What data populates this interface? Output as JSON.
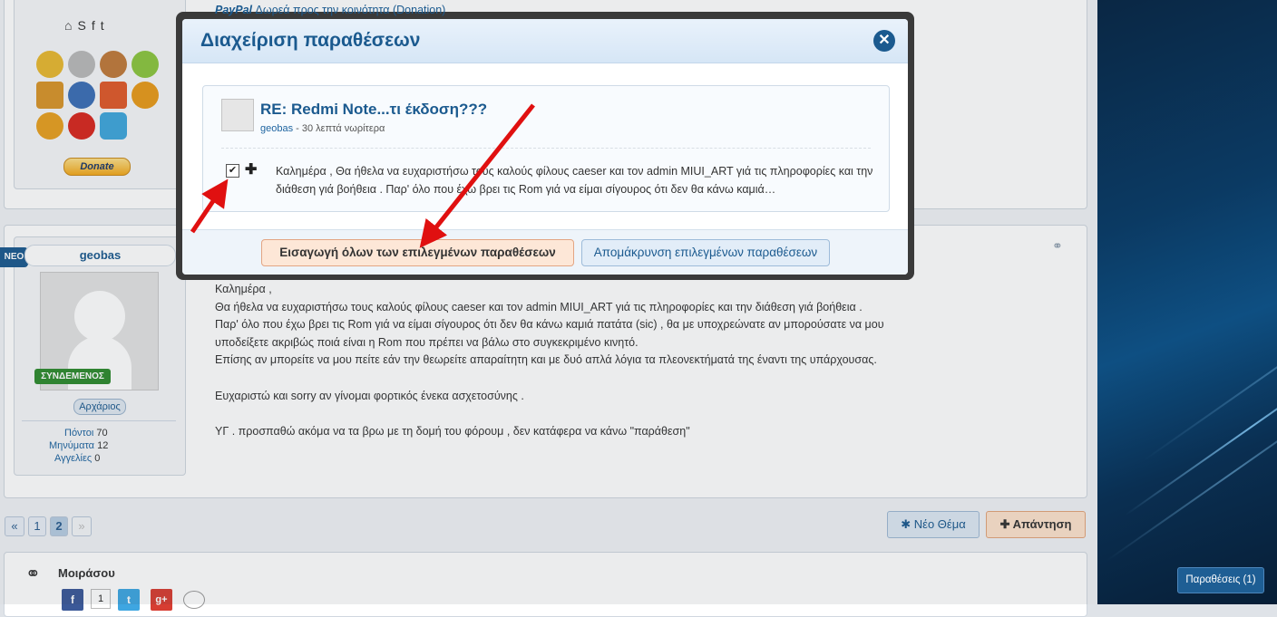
{
  "colors": {
    "accent": "#1b5a8f",
    "insert_bg": "#fde7d7",
    "online_green": "#2e8b2e",
    "arrow_red": "#e01010"
  },
  "top_post": {
    "paypal_brand": "PayPal",
    "paypal_link": "Δωρεά προς την κοινότητα (Donation)",
    "donate_label": "Donate",
    "social_icons": [
      "home-icon",
      "skype-icon",
      "facebook-icon",
      "twitter-icon"
    ]
  },
  "user": {
    "name": "geobas",
    "new_badge": "ΝΕΟ",
    "online": "ΣΥΝΔΕΜΕΝΟΣ",
    "rank": "Αρχάριος",
    "stats": [
      {
        "label": "Πόντοι",
        "value": "70"
      },
      {
        "label": "Μηνύματα",
        "value": "12"
      },
      {
        "label": "Αγγελίες",
        "value": "0"
      }
    ]
  },
  "post": {
    "lines": [
      "Καλημέρα ,",
      "Θα ήθελα να ευχαριστήσω τους καλούς φίλους caeser και τον admin MIUI_ART γιά τις πληροφορίες και την διάθεση γιά βοήθεια .",
      "Παρ' όλο που έχω βρει τις Rom γιά να είμαι σίγουρος ότι δεν θα κάνω καμιά πατάτα (sic) , θα με υποχρεώνατε αν μπορούσατε να μου",
      "υποδείξετε ακριβώς ποιά είναι η Rom που πρέπει να βάλω στο συγκεκριμένο κινητό.",
      "Επίσης αν μπορείτε να μου πείτε εάν την θεωρείτε απαραίτητη και με δυό απλά λόγια τα πλεονεκτήματά της έναντι της υπάρχουσας.",
      "",
      "Ευχαριστώ και sorry αν γίνομαι φορτικός ένεκα ασχετοσύνης .",
      "",
      "ΥΓ . προσπαθώ ακόμα να τα βρω με τη δομή του φόρουμ , δεν κατάφερα να κάνω \"παράθεση\""
    ]
  },
  "pagination": {
    "prev": "«",
    "pages": [
      "1",
      "2"
    ],
    "current": "2",
    "next": "»"
  },
  "actions": {
    "new_topic": "Νέο Θέμα",
    "reply": "Απάντηση"
  },
  "share": {
    "title": "Μοιράσου",
    "fb_count": "1"
  },
  "quotes_button": "Παραθέσεις (1)",
  "modal": {
    "title": "Διαχείριση παραθέσεων",
    "quote": {
      "title": "RE: Redmi Note...τι έκδοση???",
      "author": "geobas",
      "time": "30 λεπτά νωρίτερα",
      "text": "Καλημέρα , Θα ήθελα να ευχαριστήσω τους καλούς φίλους caeser και τον admin MIUI_ART γιά τις πληροφορίες και την διάθεση γιά βοήθεια . Παρ' όλο που έχω βρει τις Rom γιά να είμαι σίγουρος ότι δεν θα κάνω καμιά…",
      "checked": true
    },
    "insert_label": "Εισαγωγή όλων των επιλεγμένων παραθέσεων",
    "remove_label": "Απομάκρυνση επιλεγμένων παραθέσεων"
  }
}
